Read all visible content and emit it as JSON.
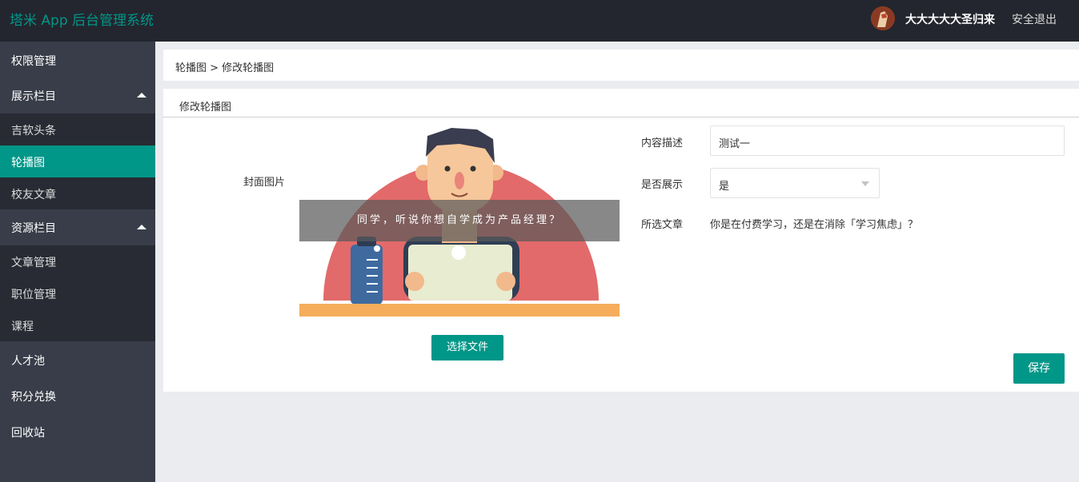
{
  "header": {
    "app_title": "塔米 App 后台管理系统",
    "username": "大大大大大圣归来",
    "logout": "安全退出"
  },
  "sidebar": {
    "items": [
      {
        "label": "权限管理"
      },
      {
        "label": "展示栏目",
        "expanded": true
      },
      {
        "label": "吉软头条"
      },
      {
        "label": "轮播图",
        "active": true
      },
      {
        "label": "校友文章"
      },
      {
        "label": "资源栏目",
        "expanded": true
      },
      {
        "label": "文章管理"
      },
      {
        "label": "职位管理"
      },
      {
        "label": "课程"
      },
      {
        "label": "人才池"
      },
      {
        "label": "积分兑换"
      },
      {
        "label": "回收站"
      }
    ]
  },
  "breadcrumb": "轮播图 > 修改轮播图",
  "panel": {
    "title": "修改轮播图",
    "cover_label": "封面图片",
    "cover_caption": "同学，听说你想自学成为产品经理？",
    "choose_file": "选择文件",
    "desc_label": "内容描述",
    "desc_value": "测试一",
    "show_label": "是否展示",
    "show_value": "是",
    "article_label": "所选文章",
    "article_value": "你是在付费学习，还是在消除「学习焦虑」？",
    "save": "保存"
  },
  "colors": {
    "accent": "#009688",
    "topbar": "#23262e",
    "sidebar": "#393d49",
    "submenu": "#282b33"
  }
}
